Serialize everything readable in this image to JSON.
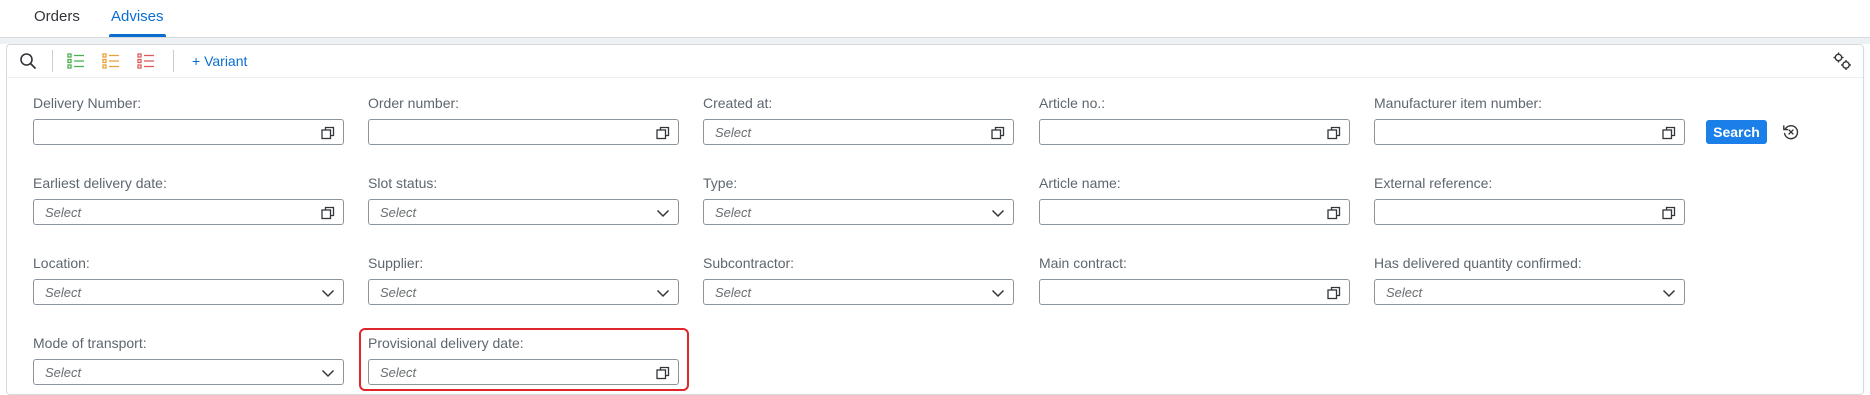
{
  "tabs": [
    {
      "label": "Orders"
    },
    {
      "label": "Advises"
    }
  ],
  "toolbar": {
    "variant_label": "+ Variant"
  },
  "fields": {
    "delivery_number": {
      "label": "Delivery Number:",
      "value": ""
    },
    "order_number": {
      "label": "Order number:",
      "value": ""
    },
    "created_at": {
      "label": "Created at:",
      "placeholder": "Select"
    },
    "article_no": {
      "label": "Article no.:",
      "value": ""
    },
    "manufacturer_item_number": {
      "label": "Manufacturer item number:",
      "value": ""
    },
    "earliest_delivery_date": {
      "label": "Earliest delivery date:",
      "placeholder": "Select"
    },
    "slot_status": {
      "label": "Slot status:",
      "placeholder": "Select"
    },
    "type": {
      "label": "Type:",
      "placeholder": "Select"
    },
    "article_name": {
      "label": "Article name:",
      "value": ""
    },
    "external_reference": {
      "label": "External reference:",
      "value": ""
    },
    "location": {
      "label": "Location:",
      "placeholder": "Select"
    },
    "supplier": {
      "label": "Supplier:",
      "placeholder": "Select"
    },
    "subcontractor": {
      "label": "Subcontractor:",
      "placeholder": "Select"
    },
    "main_contract": {
      "label": "Main contract:",
      "value": ""
    },
    "has_delivered_quantity_confirmed": {
      "label": "Has delivered quantity confirmed:",
      "placeholder": "Select"
    },
    "mode_of_transport": {
      "label": "Mode of transport:",
      "placeholder": "Select"
    },
    "provisional_delivery_date": {
      "label": "Provisional delivery date:",
      "placeholder": "Select"
    }
  },
  "actions": {
    "search_label": "Search"
  },
  "icons": {
    "search": "search-icon",
    "list_green": "list-icon",
    "list_orange": "list-icon",
    "list_red": "list-icon",
    "settings": "settings-icon",
    "value_help": "value-help-icon",
    "dropdown": "chevron-down-icon",
    "reset": "reset-icon"
  },
  "colors": {
    "accent": "#0a6ed1",
    "search_button": "#1a7fe8",
    "highlight": "#e0262b",
    "list_green": "#4caf50",
    "list_orange": "#e9a23b",
    "list_red": "#e05a5a"
  }
}
